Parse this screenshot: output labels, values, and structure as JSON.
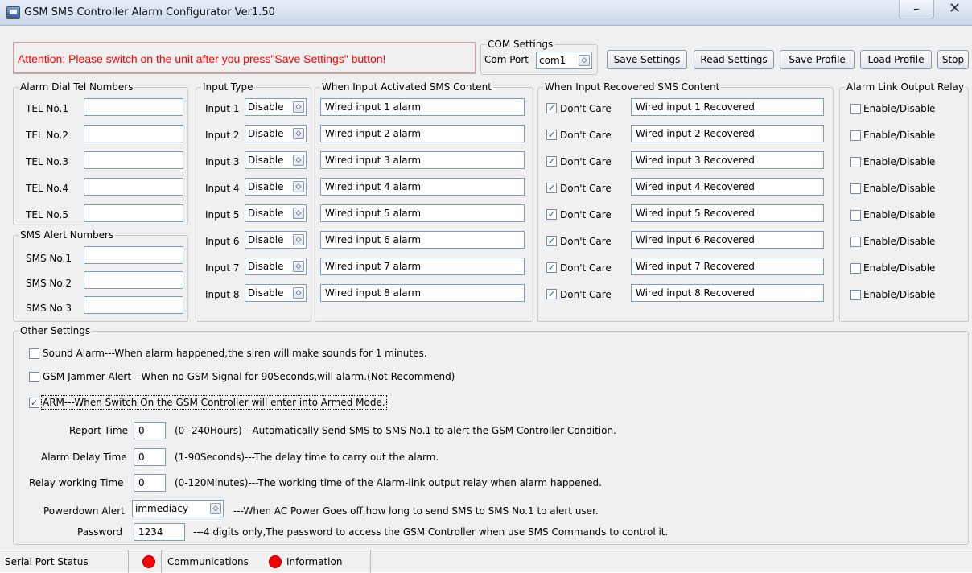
{
  "window": {
    "title": "GSM SMS Controller Alarm Configurator Ver1.50",
    "minimize_label": "–",
    "close_label": "✕"
  },
  "attention": "Attention: Please switch on the unit after you press\"Save Settings\" button!",
  "com_settings": {
    "legend": "COM Settings",
    "port_label": "Com Port",
    "port_value": "com1"
  },
  "toolbar": {
    "save_settings": "Save Settings",
    "read_settings": "Read Settings",
    "save_profile": "Save Profile",
    "load_profile": "Load Profile",
    "stop": "Stop"
  },
  "alarm_dial": {
    "legend": "Alarm Dial Tel Numbers",
    "rows": [
      {
        "label": "TEL No.1",
        "value": ""
      },
      {
        "label": "TEL No.2",
        "value": ""
      },
      {
        "label": "TEL No.3",
        "value": ""
      },
      {
        "label": "TEL No.4",
        "value": ""
      },
      {
        "label": "TEL No.5",
        "value": ""
      }
    ]
  },
  "sms_alert": {
    "legend": "SMS Alert Numbers",
    "rows": [
      {
        "label": "SMS No.1",
        "value": ""
      },
      {
        "label": "SMS No.2",
        "value": ""
      },
      {
        "label": "SMS No.3",
        "value": ""
      }
    ]
  },
  "input_type": {
    "legend": "Input Type",
    "rows": [
      {
        "label": "Input 1",
        "value": "Disable"
      },
      {
        "label": "Input 2",
        "value": "Disable"
      },
      {
        "label": "Input 3",
        "value": "Disable"
      },
      {
        "label": "Input 4",
        "value": "Disable"
      },
      {
        "label": "Input 5",
        "value": "Disable"
      },
      {
        "label": "Input 6",
        "value": "Disable"
      },
      {
        "label": "Input 7",
        "value": "Disable"
      },
      {
        "label": "Input 8",
        "value": "Disable"
      }
    ]
  },
  "activated": {
    "legend": "When Input Activated SMS Content",
    "values": [
      "Wired input 1 alarm",
      "Wired input 2 alarm",
      "Wired input 3 alarm",
      "Wired input 4 alarm",
      "Wired input 5 alarm",
      "Wired input 6 alarm",
      "Wired input 7 alarm",
      "Wired input 8 alarm"
    ]
  },
  "recovered": {
    "legend": "When Input Recovered SMS Content",
    "dont_care_label": "Don't Care",
    "rows": [
      {
        "checked": true,
        "value": "Wired input 1 Recovered"
      },
      {
        "checked": true,
        "value": "Wired input 2 Recovered"
      },
      {
        "checked": true,
        "value": "Wired input 3 Recovered"
      },
      {
        "checked": true,
        "value": "Wired input 4 Recovered"
      },
      {
        "checked": true,
        "value": "Wired input 5 Recovered"
      },
      {
        "checked": true,
        "value": "Wired input 6 Recovered"
      },
      {
        "checked": true,
        "value": "Wired input 7 Recovered"
      },
      {
        "checked": true,
        "value": "Wired input 8 Recovered"
      }
    ]
  },
  "relay": {
    "legend": "Alarm Link Output Relay",
    "item_label": "Enable/Disable",
    "checked": [
      false,
      false,
      false,
      false,
      false,
      false,
      false,
      false
    ]
  },
  "other": {
    "legend": "Other Settings",
    "sound_alarm": {
      "checked": false,
      "label": "Sound Alarm---When alarm happened,the siren will make sounds for 1 minutes."
    },
    "jammer": {
      "checked": false,
      "label": "GSM Jammer Alert---When no GSM Signal for 90Seconds,will alarm.(Not Recommend)"
    },
    "arm": {
      "checked": true,
      "label": "ARM---When Switch On the GSM Controller will enter into Armed Mode."
    },
    "report_time": {
      "label": "Report Time",
      "value": "0",
      "desc": "(0--240Hours)---Automatically Send SMS to SMS No.1 to alert the GSM Controller Condition."
    },
    "alarm_delay": {
      "label": "Alarm Delay Time",
      "value": "0",
      "desc": "(1-90Seconds)---The delay time to carry out the alarm."
    },
    "relay_time": {
      "label": "Relay working Time",
      "value": "0",
      "desc": "(0-120Minutes)---The working time of the Alarm-link output relay when alarm happened."
    },
    "powerdown": {
      "label": "Powerdown Alert",
      "value": "immediacy",
      "desc": "---When AC Power Goes off,how long to send SMS to SMS No.1 to alert user."
    },
    "password": {
      "label": "Password",
      "value": "1234",
      "desc": "---4 digits only,The password to access the GSM Controller when use SMS Commands to control it."
    }
  },
  "status": {
    "serial": "Serial Port Status",
    "communications": "Communications",
    "information": "Information",
    "led_color": "#ff0000"
  }
}
